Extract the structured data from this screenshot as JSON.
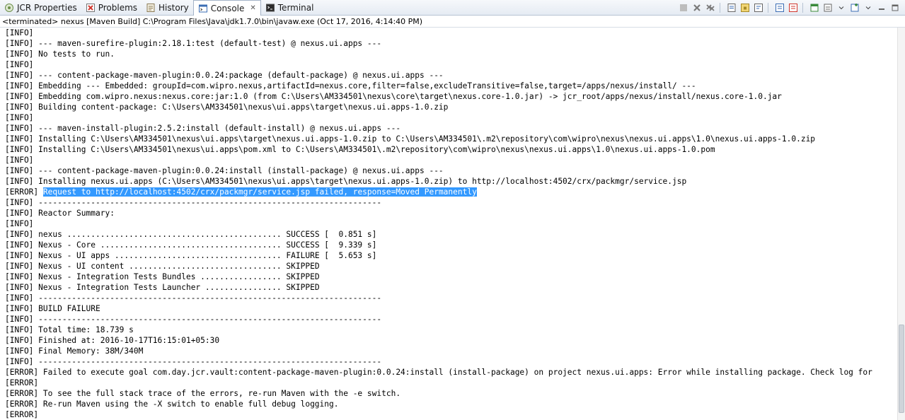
{
  "tabs": [
    {
      "label": "JCR Properties",
      "icon": "jcr-properties-icon",
      "active": false
    },
    {
      "label": "Problems",
      "icon": "problems-icon",
      "active": false
    },
    {
      "label": "History",
      "icon": "history-icon",
      "active": false
    },
    {
      "label": "Console",
      "icon": "console-icon",
      "active": true,
      "close": "✕"
    },
    {
      "label": "Terminal",
      "icon": "terminal-icon",
      "active": false
    }
  ],
  "status": "<terminated> nexus [Maven Build] C:\\Program Files\\Java\\jdk1.7.0\\bin\\javaw.exe (Oct 17, 2016, 4:14:40 PM)",
  "colors": {
    "selection": "#3399ff",
    "error_icon": "#d0342c",
    "accent": "#3b6db4"
  },
  "console": {
    "lines": [
      {
        "prefix": "[INFO]",
        "text": ""
      },
      {
        "prefix": "[INFO]",
        "text": " --- maven-surefire-plugin:2.18.1:test (default-test) @ nexus.ui.apps ---"
      },
      {
        "prefix": "[INFO]",
        "text": " No tests to run."
      },
      {
        "prefix": "[INFO]",
        "text": ""
      },
      {
        "prefix": "[INFO]",
        "text": " --- content-package-maven-plugin:0.0.24:package (default-package) @ nexus.ui.apps ---"
      },
      {
        "prefix": "[INFO]",
        "text": " Embedding --- Embedded: groupId=com.wipro.nexus,artifactId=nexus.core,filter=false,excludeTransitive=false,target=/apps/nexus/install/ ---"
      },
      {
        "prefix": "[INFO]",
        "text": " Embedding com.wipro.nexus:nexus.core:jar:1.0 (from C:\\Users\\AM334501\\nexus\\core\\target\\nexus.core-1.0.jar) -> jcr_root/apps/nexus/install/nexus.core-1.0.jar"
      },
      {
        "prefix": "[INFO]",
        "text": " Building content-package: C:\\Users\\AM334501\\nexus\\ui.apps\\target\\nexus.ui.apps-1.0.zip"
      },
      {
        "prefix": "[INFO]",
        "text": ""
      },
      {
        "prefix": "[INFO]",
        "text": " --- maven-install-plugin:2.5.2:install (default-install) @ nexus.ui.apps ---"
      },
      {
        "prefix": "[INFO]",
        "text": " Installing C:\\Users\\AM334501\\nexus\\ui.apps\\target\\nexus.ui.apps-1.0.zip to C:\\Users\\AM334501\\.m2\\repository\\com\\wipro\\nexus\\nexus.ui.apps\\1.0\\nexus.ui.apps-1.0.zip"
      },
      {
        "prefix": "[INFO]",
        "text": " Installing C:\\Users\\AM334501\\nexus\\ui.apps\\pom.xml to C:\\Users\\AM334501\\.m2\\repository\\com\\wipro\\nexus\\nexus.ui.apps\\1.0\\nexus.ui.apps-1.0.pom"
      },
      {
        "prefix": "[INFO]",
        "text": ""
      },
      {
        "prefix": "[INFO]",
        "text": " --- content-package-maven-plugin:0.0.24:install (install-package) @ nexus.ui.apps ---"
      },
      {
        "prefix": "[INFO]",
        "text": " Installing nexus.ui.apps (C:\\Users\\AM334501\\nexus\\ui.apps\\target\\nexus.ui.apps-1.0.zip) to http://localhost:4502/crx/packmgr/service.jsp"
      },
      {
        "prefix": "[ERROR]",
        "text": " ",
        "highlight": "Request to http://localhost:4502/crx/packmgr/service.jsp failed, response=Moved Permanently"
      },
      {
        "prefix": "[INFO]",
        "text": " ------------------------------------------------------------------------"
      },
      {
        "prefix": "[INFO]",
        "text": " Reactor Summary:"
      },
      {
        "prefix": "[INFO]",
        "text": ""
      },
      {
        "prefix": "[INFO]",
        "text": " nexus ............................................. SUCCESS [  0.851 s]"
      },
      {
        "prefix": "[INFO]",
        "text": " Nexus - Core ...................................... SUCCESS [  9.339 s]"
      },
      {
        "prefix": "[INFO]",
        "text": " Nexus - UI apps ................................... FAILURE [  5.653 s]"
      },
      {
        "prefix": "[INFO]",
        "text": " Nexus - UI content ................................ SKIPPED"
      },
      {
        "prefix": "[INFO]",
        "text": " Nexus - Integration Tests Bundles ................. SKIPPED"
      },
      {
        "prefix": "[INFO]",
        "text": " Nexus - Integration Tests Launcher ................ SKIPPED"
      },
      {
        "prefix": "[INFO]",
        "text": " ------------------------------------------------------------------------"
      },
      {
        "prefix": "[INFO]",
        "text": " BUILD FAILURE"
      },
      {
        "prefix": "[INFO]",
        "text": " ------------------------------------------------------------------------"
      },
      {
        "prefix": "[INFO]",
        "text": " Total time: 18.739 s"
      },
      {
        "prefix": "[INFO]",
        "text": " Finished at: 2016-10-17T16:15:01+05:30"
      },
      {
        "prefix": "[INFO]",
        "text": " Final Memory: 38M/340M"
      },
      {
        "prefix": "[INFO]",
        "text": " ------------------------------------------------------------------------"
      },
      {
        "prefix": "[ERROR]",
        "text": " Failed to execute goal com.day.jcr.vault:content-package-maven-plugin:0.0.24:install (install-package) on project nexus.ui.apps: Error while installing package. Check log for"
      },
      {
        "prefix": "[ERROR]",
        "text": ""
      },
      {
        "prefix": "[ERROR]",
        "text": " To see the full stack trace of the errors, re-run Maven with the -e switch."
      },
      {
        "prefix": "[ERROR]",
        "text": " Re-run Maven using the -X switch to enable full debug logging."
      },
      {
        "prefix": "[ERROR]",
        "text": ""
      }
    ]
  }
}
